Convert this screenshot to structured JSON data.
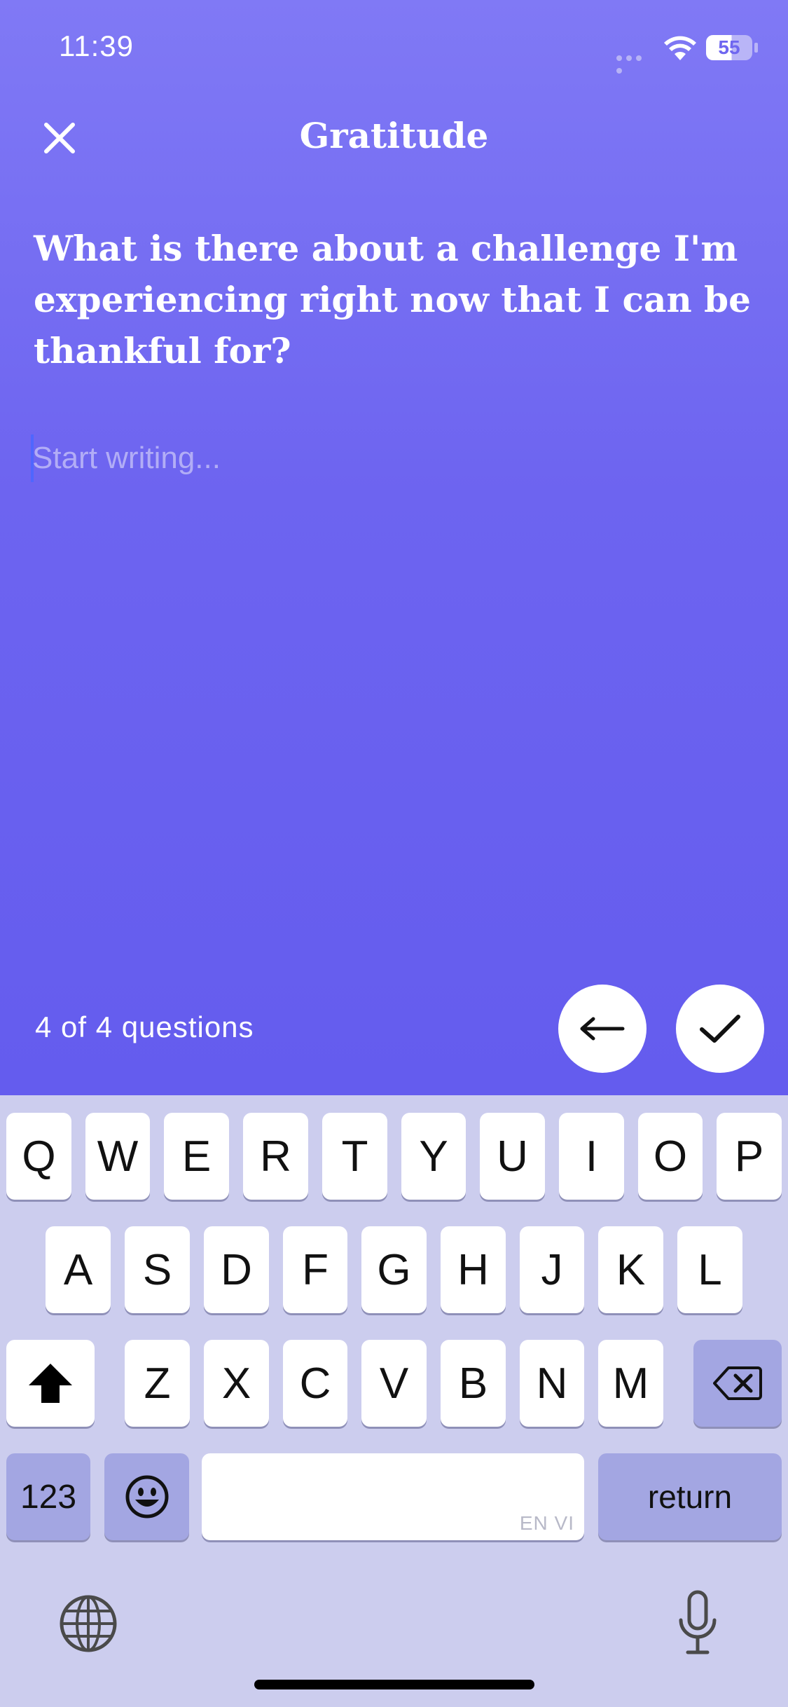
{
  "status_bar": {
    "time": "11:39",
    "battery": "55"
  },
  "header": {
    "title": "Gratitude",
    "close_icon": "close-icon"
  },
  "prompt": {
    "question": "What is there about a challenge I'm experiencing right now that I can be thankful for?"
  },
  "editor": {
    "placeholder": "Start writing..."
  },
  "footer": {
    "progress_text": "4 of 4 questions",
    "back_icon": "arrow-left-icon",
    "done_icon": "checkmark-icon"
  },
  "keyboard": {
    "row1": [
      "Q",
      "W",
      "E",
      "R",
      "T",
      "Y",
      "U",
      "I",
      "O",
      "P"
    ],
    "row2": [
      "A",
      "S",
      "D",
      "F",
      "G",
      "H",
      "J",
      "K",
      "L"
    ],
    "row3": [
      "Z",
      "X",
      "C",
      "V",
      "B",
      "N",
      "M"
    ],
    "numbers_label": "123",
    "return_label": "return",
    "space_language": "EN VI"
  },
  "colors": {
    "gradient_top": "#8079f5",
    "gradient_bottom": "#645cee",
    "keyboard_bg": "#cccdee"
  }
}
